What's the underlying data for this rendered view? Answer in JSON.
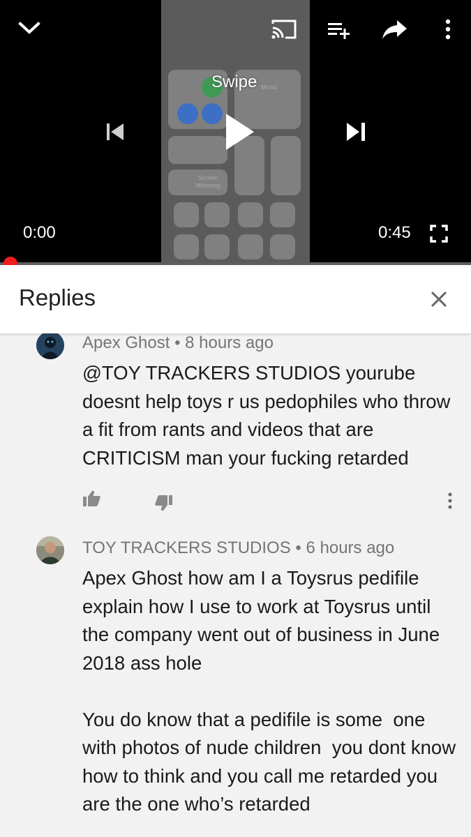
{
  "player": {
    "overlay_text": "Swipe",
    "current_time": "0:00",
    "duration": "0:45",
    "progress_fraction": 0.0,
    "thumbnail_labels": {
      "music": "Music",
      "screen_mirroring": "Screen\nMirroring"
    }
  },
  "replies": {
    "title": "Replies"
  },
  "comments": [
    {
      "author": "Apex Ghost",
      "time": "8 hours ago",
      "text": "@TOY TRACKERS STUDIOS yourube doesnt help toys r us pedophiles who throw a fit from rants and videos that are CRITICISM man your fucking retarded"
    },
    {
      "author": "TOY TRACKERS STUDIOS",
      "time": "6 hours ago",
      "text": "Apex Ghost how am I a Toysrus pedifile explain how I use to work at Toysrus until the company went out of business in June 2018 ass hole\n\nYou do know that a pedifile is some  one with photos of nude children  you dont know how to think and you call me retarded you are the one who’s retarded"
    }
  ],
  "separator": " • ",
  "colors": {
    "player_bg": "#000000",
    "progress": "#ff0000",
    "page_bg": "#f2f2f2",
    "header_bg": "#ffffff",
    "meta_text": "#757575",
    "body_text": "#1a1a1a"
  },
  "icons": [
    "chevron-down-icon",
    "cast-icon",
    "add-to-playlist-icon",
    "share-icon",
    "more-vertical-icon",
    "previous-icon",
    "play-icon",
    "next-icon",
    "fullscreen-icon",
    "close-icon",
    "thumb-up-icon",
    "thumb-down-icon"
  ]
}
